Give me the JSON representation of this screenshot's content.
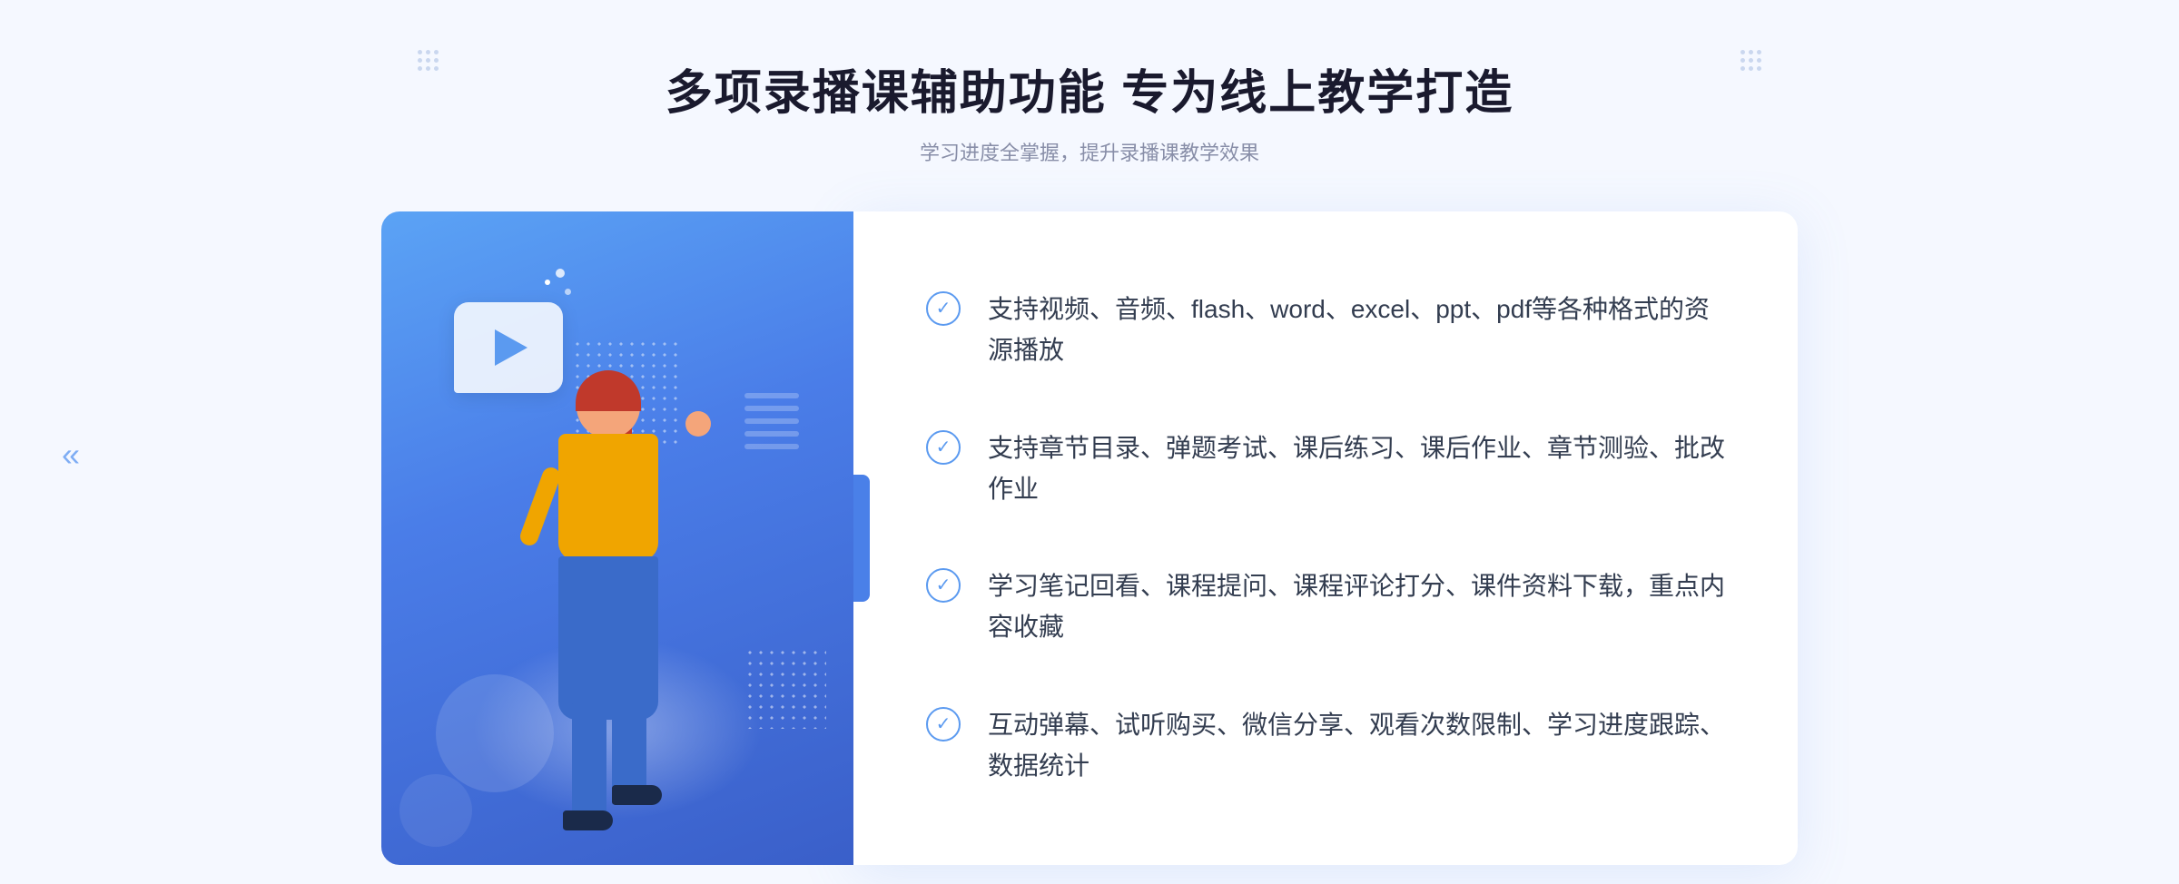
{
  "page": {
    "background_color": "#f5f8ff"
  },
  "header": {
    "main_title": "多项录播课辅助功能 专为线上教学打造",
    "sub_title": "学习进度全掌握，提升录播课教学效果"
  },
  "features": [
    {
      "id": 1,
      "text": "支持视频、音频、flash、word、excel、ppt、pdf等各种格式的资源播放"
    },
    {
      "id": 2,
      "text": "支持章节目录、弹题考试、课后练习、课后作业、章节测验、批改作业"
    },
    {
      "id": 3,
      "text": "学习笔记回看、课程提问、课程评论打分、课件资料下载，重点内容收藏"
    },
    {
      "id": 4,
      "text": "互动弹幕、试听购买、微信分享、观看次数限制、学习进度跟踪、数据统计"
    }
  ],
  "icons": {
    "check": "✓",
    "play": "▶",
    "chevron_left": "«"
  },
  "colors": {
    "primary_blue": "#5b9af0",
    "dark_blue": "#3a5fc9",
    "title_dark": "#1a1a2e",
    "text_gray": "#888ea8",
    "feature_text": "#333d50"
  }
}
